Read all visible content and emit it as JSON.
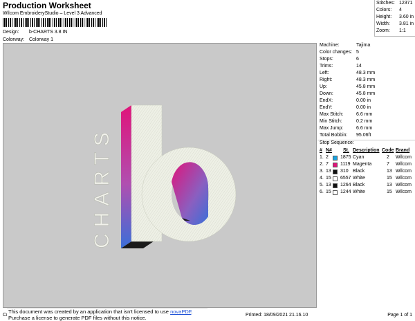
{
  "header": {
    "title": "Production Worksheet",
    "subtitle": "Wilcom EmbroideryStudio – Level 3 Advanced",
    "design_label": "Design:",
    "design_value": "b-CHARTS 3.8 IN",
    "colorway_label": "Colorway:",
    "colorway_value": "Colorway 1"
  },
  "stats": [
    {
      "label": "Stitches:",
      "value": "12371"
    },
    {
      "label": "Colors:",
      "value": "4"
    },
    {
      "label": "Height:",
      "value": "3.60 in"
    },
    {
      "label": "Width:",
      "value": "3.81 in"
    },
    {
      "label": "Zoom:",
      "value": "1:1"
    }
  ],
  "machine_info": [
    {
      "label": "Machine:",
      "value": "Tajima"
    },
    {
      "label": "Color changes:",
      "value": "5"
    },
    {
      "label": "Stops:",
      "value": "6"
    },
    {
      "label": "Trims:",
      "value": "14"
    },
    {
      "label": "Left:",
      "value": "48.3 mm"
    },
    {
      "label": "Right:",
      "value": "48.3 mm"
    },
    {
      "label": "Up:",
      "value": "45.8 mm"
    },
    {
      "label": "Down:",
      "value": "45.8 mm"
    },
    {
      "label": "EndX:",
      "value": "0.00 in"
    },
    {
      "label": "EndY:",
      "value": "0.00 in"
    },
    {
      "label": "Max Stitch:",
      "value": "6.6 mm"
    },
    {
      "label": "Min Stitch:",
      "value": "0.2 mm"
    },
    {
      "label": "Max Jump:",
      "value": "6.6 mm"
    },
    {
      "label": "Total Bobbin:",
      "value": "95.06ft"
    }
  ],
  "stop_sequence": {
    "title": "Stop Sequence:",
    "headers": {
      "num": "#",
      "n": "N#",
      "st": "St.",
      "desc": "Description",
      "code": "Code",
      "brand": "Brand"
    },
    "rows": [
      {
        "num": "1.",
        "n": "2",
        "st": "1875",
        "color": "#1aa3e0",
        "desc": "Cyan",
        "code": "2",
        "brand": "Wilcom"
      },
      {
        "num": "2.",
        "n": "7",
        "st": "1119",
        "color": "#e0147a",
        "desc": "Magenta",
        "code": "7",
        "brand": "Wilcom"
      },
      {
        "num": "3.",
        "n": "13",
        "st": "310",
        "color": "#111111",
        "desc": "Black",
        "code": "13",
        "brand": "Wilcom"
      },
      {
        "num": "4.",
        "n": "15",
        "st": "6557",
        "color": "#ffffff",
        "desc": "White",
        "code": "15",
        "brand": "Wilcom"
      },
      {
        "num": "5.",
        "n": "13",
        "st": "1264",
        "color": "#111111",
        "desc": "Black",
        "code": "13",
        "brand": "Wilcom"
      },
      {
        "num": "6.",
        "n": "15",
        "st": "1244",
        "color": "#ffffff",
        "desc": "White",
        "code": "15",
        "brand": "Wilcom"
      }
    ]
  },
  "design": {
    "charts_text": "CHARTS"
  },
  "footer": {
    "cr": "Cr",
    "novapdf_line1_prefix": "This document was created by an application that isn't licensed to use ",
    "novapdf_link": "novaPDF",
    "novapdf_line1_suffix": ".",
    "novapdf_line2": "Purchase a license to generate PDF files without this notice.",
    "printed": "Printed: 18/09/2021 21.16.10",
    "page": "Page 1 of 1"
  }
}
